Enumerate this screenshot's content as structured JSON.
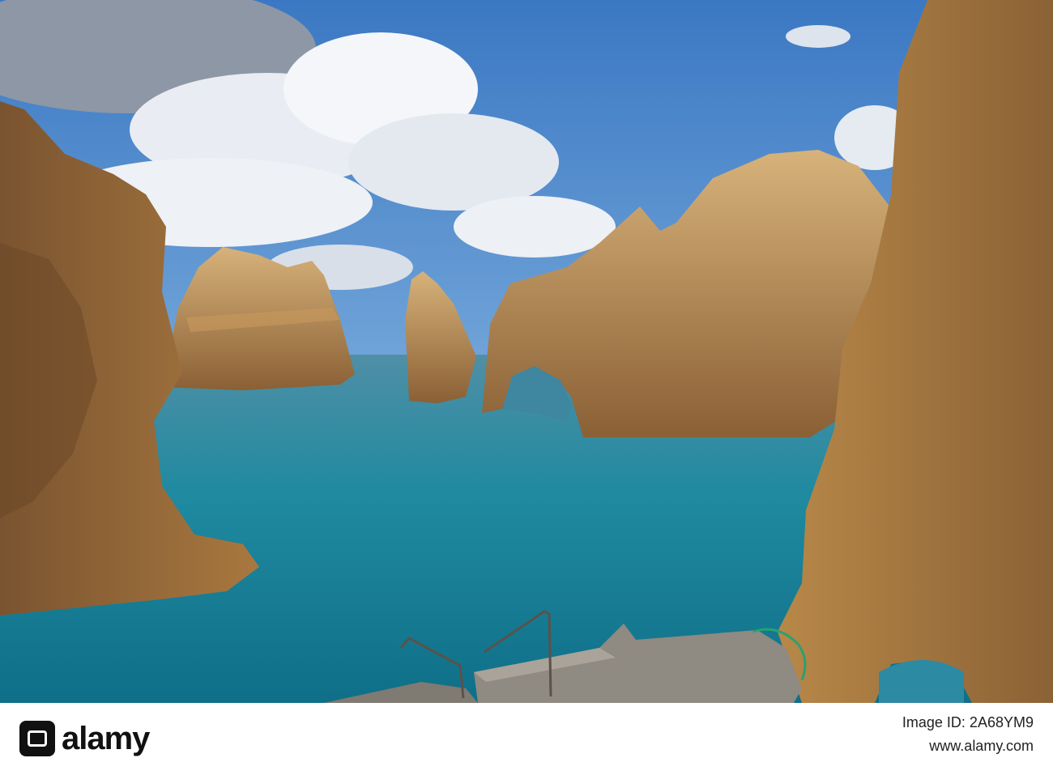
{
  "watermark": {
    "brand_text": "alamy"
  },
  "footer": {
    "logo_text": "alamy",
    "image_id_label": "Image ID: 2A68YM9",
    "site_url": "www.alamy.com"
  },
  "colors": {
    "sky": "#3f7fc6",
    "sea": "#1f8fa0",
    "rock": "#b98a4e"
  }
}
